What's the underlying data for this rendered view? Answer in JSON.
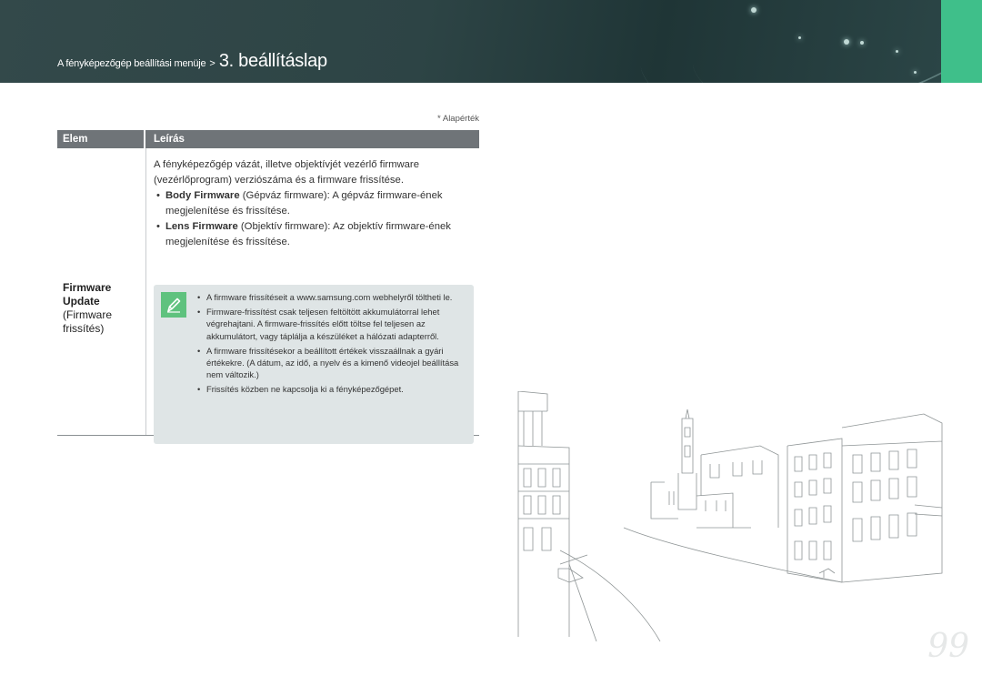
{
  "header": {
    "breadcrumb_small": "A fényképezőgép beállítási menüje",
    "breadcrumb_sep": ">",
    "title": "3. beállításlap",
    "accent_color": "#3fbf8a"
  },
  "default_note": "* Alapérték",
  "table": {
    "headers": {
      "elem": "Elem",
      "desc": "Leírás"
    },
    "row": {
      "elem_name": "Firmware Update",
      "elem_sub": "(Firmware frissítés)",
      "intro": "A fényképezőgép vázát, illetve objektívjét vezérlő firmware (vezérlőprogram) verziószáma és a firmware frissítése.",
      "bullets": [
        {
          "bold": "Body Firmware",
          "text": " (Gépváz firmware): A gépváz firmware-ének megjelenítése és frissítése."
        },
        {
          "bold": "Lens Firmware",
          "text": " (Objektív firmware): Az objektív firmware-ének megjelenítése és frissítése."
        }
      ],
      "notes": [
        "A firmware frissítéseit a www.samsung.com webhelyről töltheti le.",
        "Firmware-frissítést csak teljesen feltöltött akkumulátorral lehet végrehajtani. A firmware-frissítés előtt töltse fel teljesen az akkumulátort, vagy táplálja a készüléket a hálózati adapterről.",
        "A firmware frissítésekor a beállított értékek visszaállnak a gyári értékekre. (A dátum, az idő, a nyelv és a kimenő videojel beállítása nem változik.)",
        "Frissítés közben ne kapcsolja ki a fényképezőgépet."
      ],
      "note_icon": "pencil-note-icon"
    }
  },
  "page_number": "99"
}
